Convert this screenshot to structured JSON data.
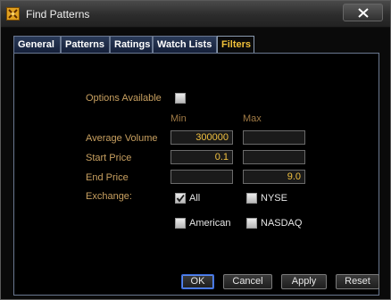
{
  "window": {
    "title": "Find Patterns",
    "app_icon": "find-patterns-app-icon",
    "close_icon": "close-x-icon"
  },
  "tabs": [
    {
      "label": "General",
      "active": false
    },
    {
      "label": "Patterns",
      "active": false
    },
    {
      "label": "Ratings",
      "active": false
    },
    {
      "label": "Watch Lists",
      "active": false
    },
    {
      "label": "Filters",
      "active": true
    }
  ],
  "filters": {
    "options_available": {
      "label": "Options Available",
      "checked": false
    },
    "column_min": "Min",
    "column_max": "Max",
    "average_volume": {
      "label": "Average Volume",
      "min": "300000",
      "max": ""
    },
    "start_price": {
      "label": "Start Price",
      "min": "0.1",
      "max": ""
    },
    "end_price": {
      "label": "End Price",
      "min": "",
      "max": "9.0"
    },
    "exchange": {
      "label": "Exchange:",
      "options": [
        {
          "label": "All",
          "checked": true
        },
        {
          "label": "NYSE",
          "checked": false
        },
        {
          "label": "American",
          "checked": false
        },
        {
          "label": "NASDAQ",
          "checked": false
        }
      ]
    }
  },
  "buttons": {
    "ok": "OK",
    "cancel": "Cancel",
    "apply": "Apply",
    "reset": "Reset"
  },
  "colors": {
    "accent_tab": "#f2c23a",
    "label": "#c8a060",
    "value": "#f0c040",
    "primary_border": "#3a6ad8"
  }
}
